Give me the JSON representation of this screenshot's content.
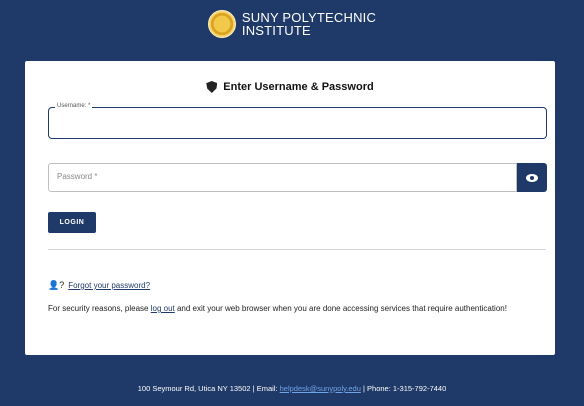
{
  "header": {
    "logo_line1": "SUNY POLYTECHNIC",
    "logo_line2": "INSTITUTE"
  },
  "card": {
    "title": "Enter Username & Password",
    "username_label": "Username: *",
    "username_value": "",
    "password_placeholder": "Password *",
    "password_value": "",
    "login_label": "LOGIN",
    "forgot_link": "Forgot your password?",
    "security_prefix": "For security reasons, please ",
    "logout_link": "log out",
    "security_suffix": " and exit your web browser when you are done accessing services that require authentication!"
  },
  "footer": {
    "address": "100 Seymour Rd, Utica NY 13502 | Email: ",
    "email": "helpdesk@sunypoly.edu",
    "phone": " | Phone: 1-315-792-7440"
  },
  "colors": {
    "background": "#1f3a68",
    "accent": "#1f3a68",
    "card": "#ffffff",
    "link": "#1f3a68"
  },
  "icons": {
    "shield": "shield-icon",
    "eye": "eye-icon",
    "user_question": "user-question-icon",
    "seal": "university-seal-icon"
  }
}
